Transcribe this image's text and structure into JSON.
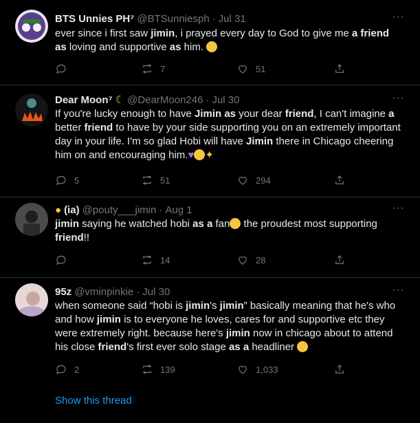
{
  "tweets": [
    {
      "name": "BTS Unnies PH⁷",
      "handle": "@BTSunniesph",
      "date": "Jul 31",
      "text_parts": [
        "ever since i first saw ",
        "jimin",
        ", i prayed every day to God to give me ",
        "a friend as",
        " loving and supportive ",
        "as",
        " him. "
      ],
      "reply": "",
      "retweet": "7",
      "like": "51"
    },
    {
      "name": "Dear Moon⁷",
      "handle": "@DearMoon246",
      "date": "Jul 30",
      "text_parts": [
        "If you're lucky enough to have ",
        "Jimin as",
        " your dear ",
        "friend",
        ", I can't imagine ",
        "a",
        " better ",
        "friend",
        " to have by your side supporting you on an extremely important day in your life. I'm so glad Hobi will have ",
        "Jimin",
        " there in Chicago cheering him on and encouraging him."
      ],
      "reply": "5",
      "retweet": "51",
      "like": "294"
    },
    {
      "name": "(ia)",
      "handle": "@pouty___jimin",
      "date": "Aug 1",
      "text_parts": [
        "jimin",
        " saying he watched hobi ",
        "as a",
        " fan",
        " the proudest most supporting ",
        "friend",
        "!!"
      ],
      "reply": "",
      "retweet": "14",
      "like": "28"
    },
    {
      "name": "95z",
      "handle": "@vminpinkie",
      "date": "Jul 30",
      "text_parts": [
        "when someone said “hobi is ",
        "jimin",
        "'s ",
        "jimin",
        "” basically meaning that he's who and how ",
        "jimin",
        " is to everyone he loves,  cares for and supportive etc they were extremely right. because here's ",
        "jimin",
        " now in chicago about to attend his close ",
        "friend",
        "'s first ever solo stage ",
        "as a",
        " headliner "
      ],
      "reply": "2",
      "retweet": "139",
      "like": "1,033"
    }
  ],
  "show_thread": "Show this thread",
  "more_label": "···"
}
